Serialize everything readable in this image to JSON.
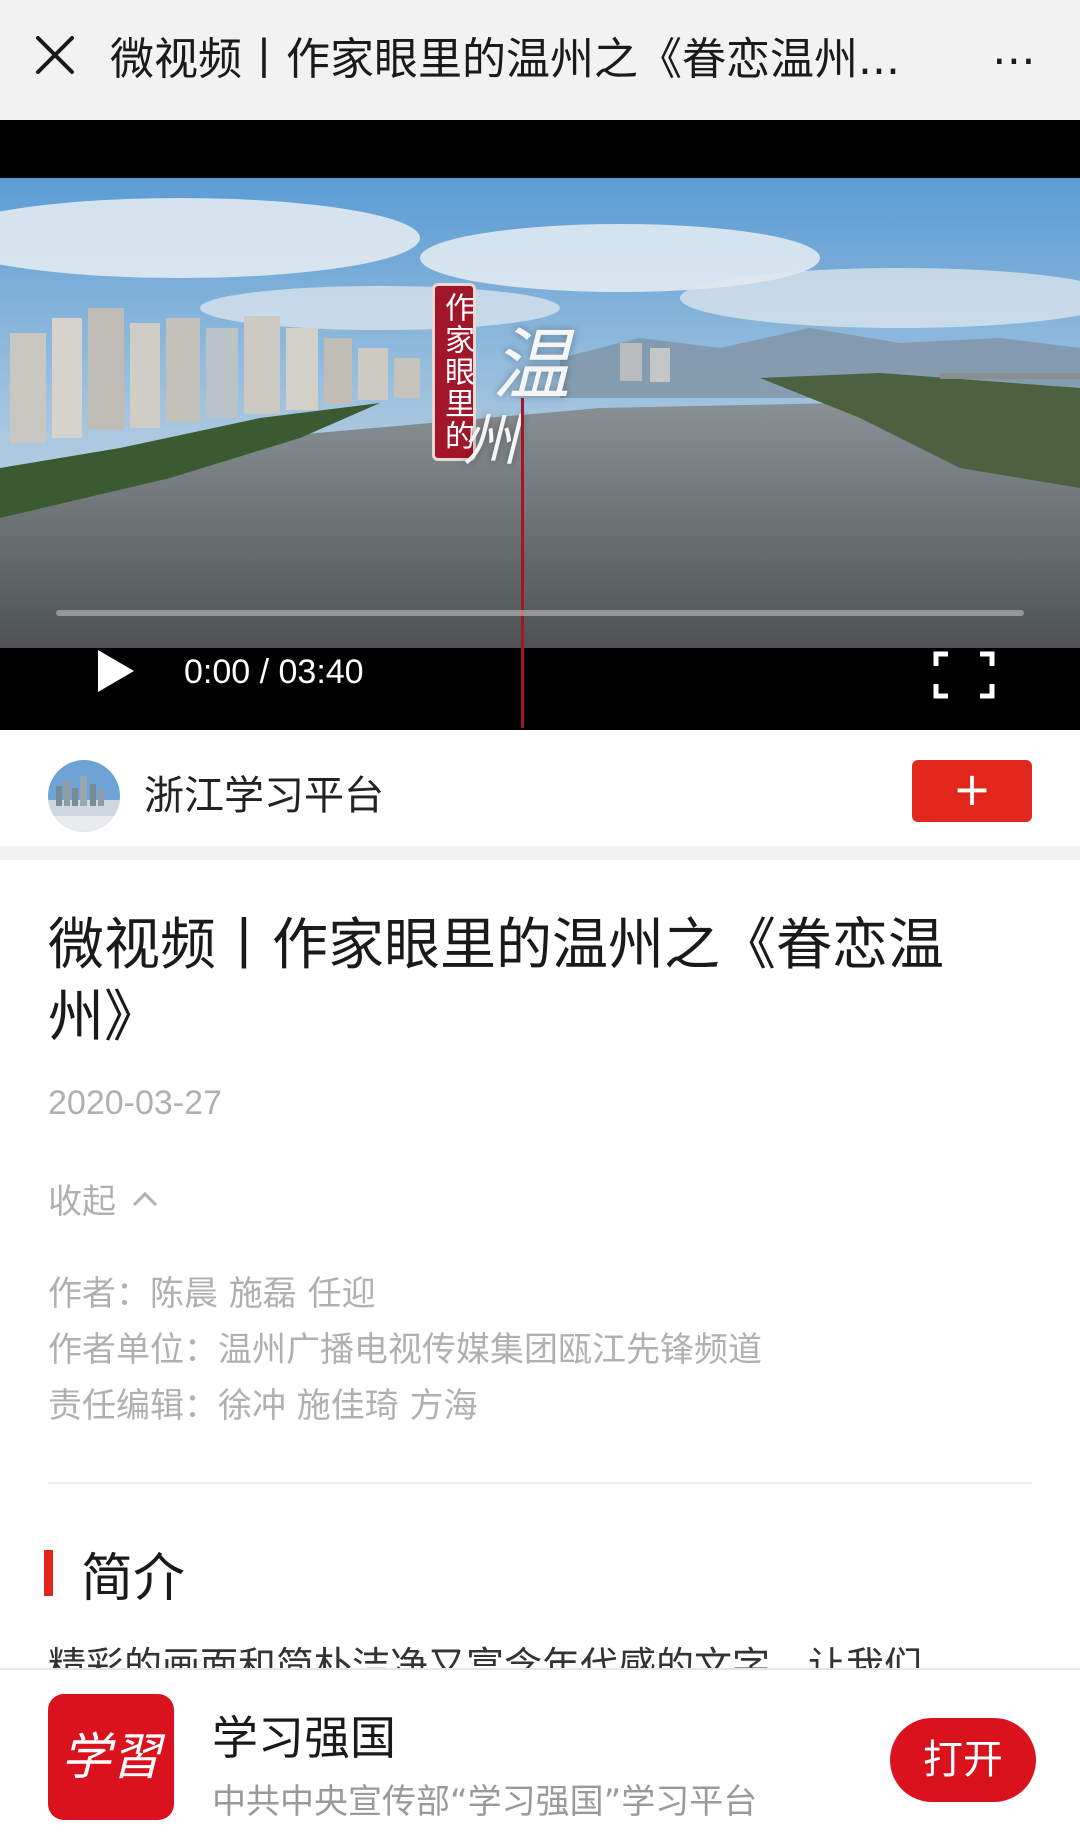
{
  "topbar": {
    "close_icon": "close-icon",
    "title": "微视频丨作家眼里的温州之《眷恋温州...",
    "more_label": "⋯",
    "more_icon": "more-icon"
  },
  "player": {
    "overlay_badge": "作家眼里的",
    "overlay_char1": "温",
    "overlay_char2": "州",
    "time_display": "0:00 / 03:40",
    "progress": 0,
    "play_icon": "play-icon",
    "fullscreen_icon": "fullscreen-icon"
  },
  "channel": {
    "name": "浙江学习平台",
    "follow_label": "+"
  },
  "article": {
    "title": "微视频丨作家眼里的温州之《眷恋温州》",
    "date": "2020-03-27",
    "collapse_label": "收起",
    "credits": [
      {
        "label": "作者：",
        "value": "陈晨 施磊 任迎"
      },
      {
        "label": "作者单位：",
        "value": "温州广播电视传媒集团瓯江先锋频道"
      },
      {
        "label": "责任编辑：",
        "value": "徐冲 施佳琦 方海"
      }
    ],
    "section_title": "简介",
    "intro": "精彩的画面和简朴洁净又富含年代感的文字，让我们"
  },
  "app_banner": {
    "logo_text": "学習",
    "name": "学习强国",
    "subtitle": "中共中央宣传部“学习强国”学习平台",
    "open_label": "打开"
  },
  "colors": {
    "accent_red": "#e1261c",
    "brand_red": "#d9121d",
    "muted_text": "#b0b0b0"
  }
}
